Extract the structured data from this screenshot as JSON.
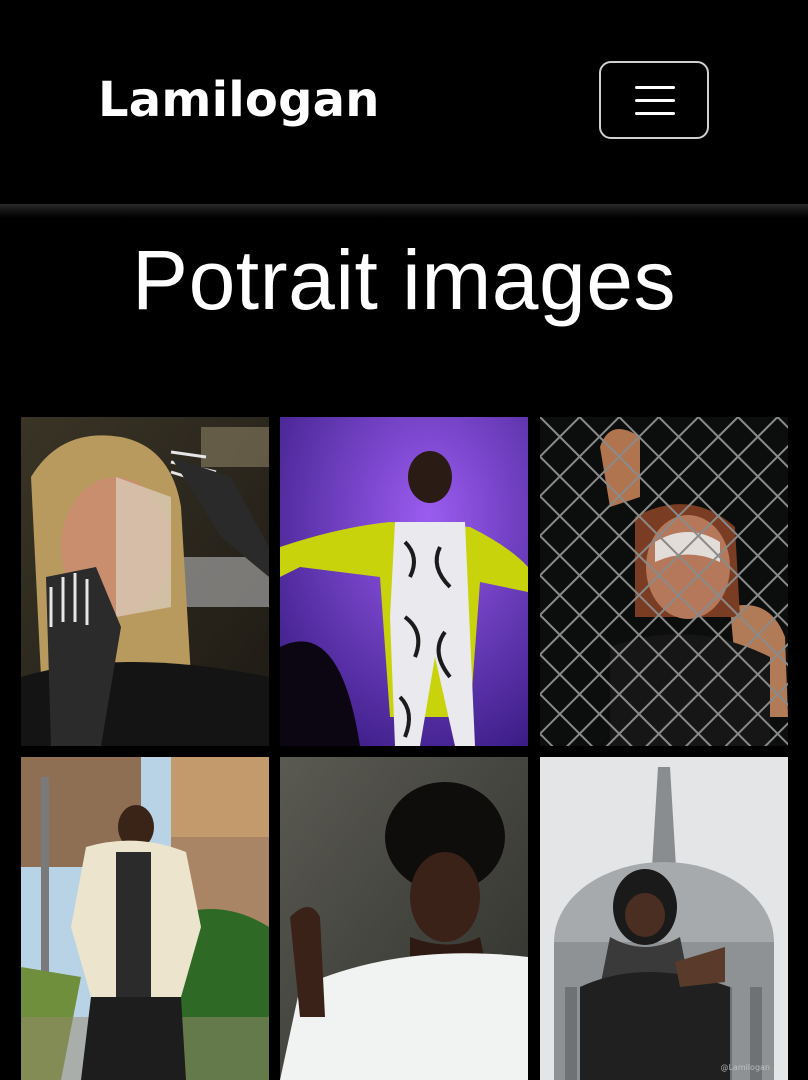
{
  "navbar": {
    "brand": "Lamilogan",
    "menu_icon": "hamburger-menu-icon"
  },
  "page": {
    "title": "Potrait images"
  },
  "gallery": {
    "photos": [
      {
        "subject": "skeleton-makeup-portrait"
      },
      {
        "subject": "purple-stage-yellow-coat-portrait"
      },
      {
        "subject": "chain-link-fence-face-paint-portrait"
      },
      {
        "subject": "man-cream-jacket-outdoor-portrait"
      },
      {
        "subject": "woman-white-shirt-studio-portrait"
      },
      {
        "subject": "man-scarf-dome-portrait"
      }
    ],
    "watermark": "@Lamilogan"
  },
  "colors": {
    "background": "#000000",
    "text": "#ffffff",
    "button_border": "#cfcfcf"
  }
}
